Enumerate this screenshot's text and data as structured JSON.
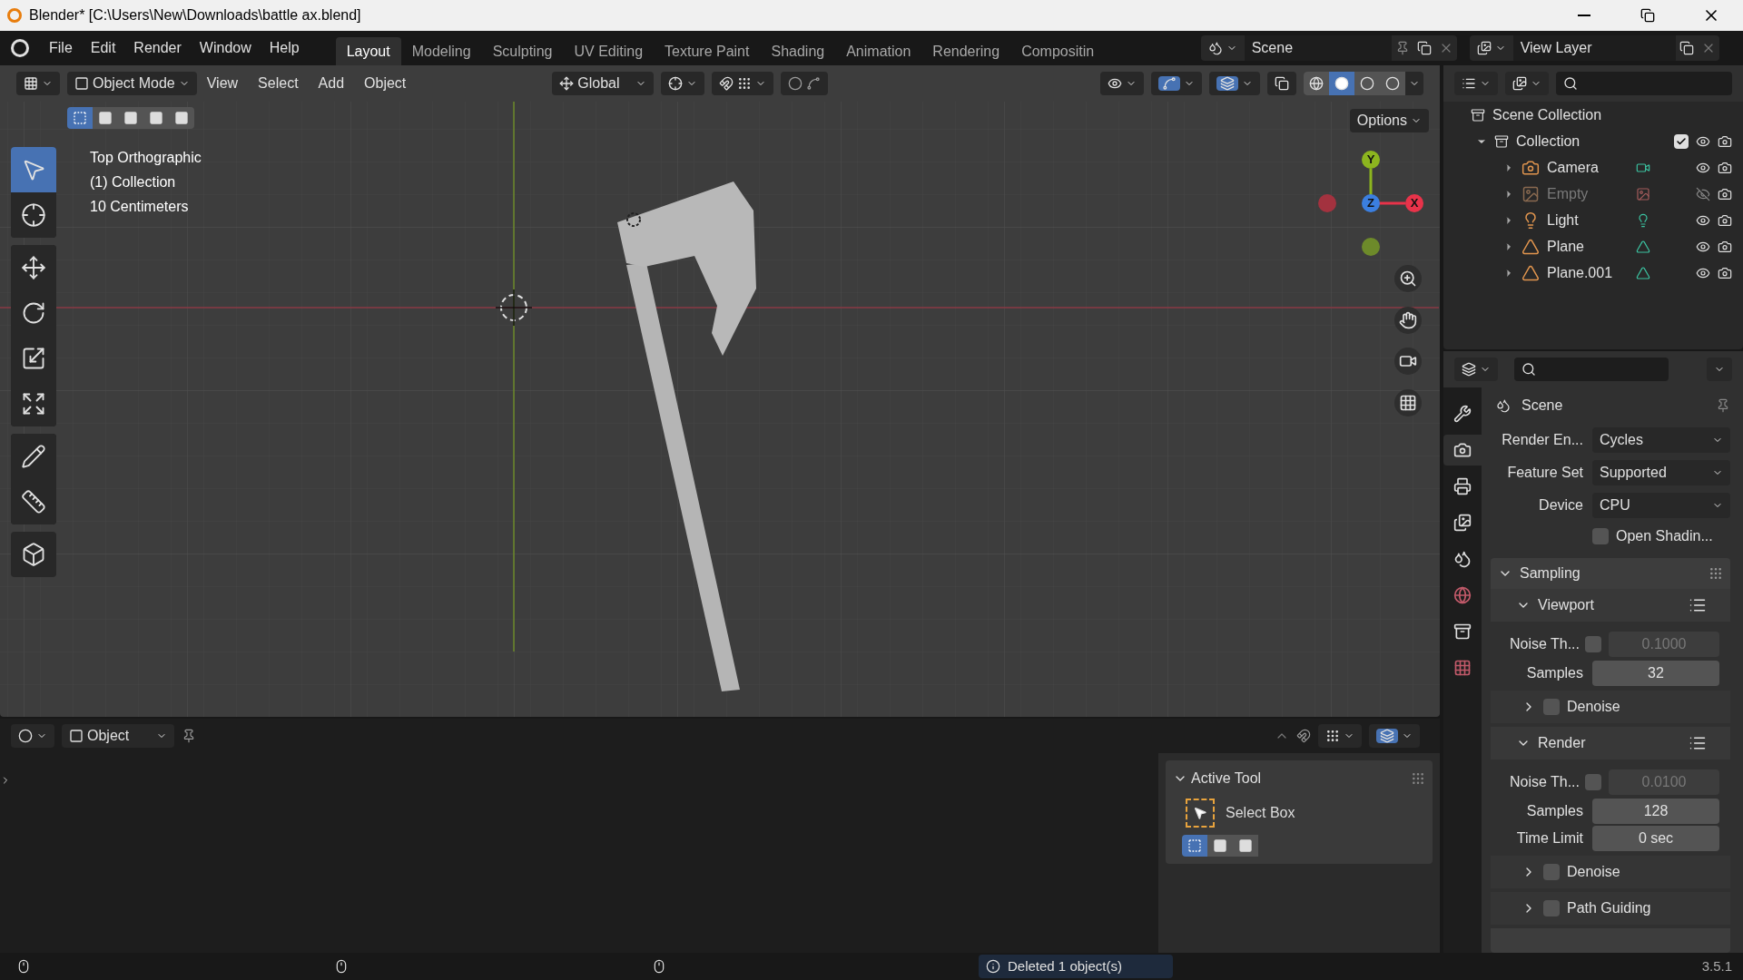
{
  "window": {
    "title": "Blender* [C:\\Users\\New\\Downloads\\battle ax.blend]"
  },
  "menu": [
    "File",
    "Edit",
    "Render",
    "Window",
    "Help"
  ],
  "workspaces": [
    {
      "label": "Layout",
      "selected": true
    },
    {
      "label": "Modeling",
      "selected": false
    },
    {
      "label": "Sculpting",
      "selected": false
    },
    {
      "label": "UV Editing",
      "selected": false
    },
    {
      "label": "Texture Paint",
      "selected": false
    },
    {
      "label": "Shading",
      "selected": false
    },
    {
      "label": "Animation",
      "selected": false
    },
    {
      "label": "Rendering",
      "selected": false
    },
    {
      "label": "Compositin",
      "selected": false
    }
  ],
  "scene": "Scene",
  "view_layer": "View Layer",
  "viewport": {
    "mode": "Object Mode",
    "menus": [
      "View",
      "Select",
      "Add",
      "Object"
    ],
    "orientation": "Global",
    "options": "Options",
    "select_modes": [
      {
        "selected": true
      },
      {
        "selected": false
      },
      {
        "selected": false
      },
      {
        "selected": false
      },
      {
        "selected": false
      }
    ],
    "shading_modes": [
      {
        "kind": "wire",
        "selected": false
      },
      {
        "kind": "solid",
        "selected": true
      },
      {
        "kind": "material",
        "selected": false
      },
      {
        "kind": "rendered",
        "selected": false
      }
    ],
    "info": [
      "Top Orthographic",
      "(1) Collection",
      "10 Centimeters"
    ],
    "axes": [
      {
        "label": "Y",
        "color": "#8cb51f"
      },
      {
        "label": "Z",
        "color": "#3b7fe0"
      },
      {
        "label": "X",
        "color": "#e8334a"
      }
    ],
    "tool_groups": [
      {
        "tools": [
          {
            "kind": "select",
            "selected": true
          },
          {
            "kind": "cursor",
            "selected": false
          }
        ]
      },
      {
        "tools": [
          {
            "kind": "move",
            "selected": false
          },
          {
            "kind": "rotate",
            "selected": false
          },
          {
            "kind": "scale",
            "selected": false
          },
          {
            "kind": "transform",
            "selected": false
          }
        ]
      },
      {
        "tools": [
          {
            "kind": "annotate",
            "selected": false
          },
          {
            "kind": "measure",
            "selected": false
          }
        ]
      },
      {
        "tools": [
          {
            "kind": "add",
            "selected": false
          }
        ]
      }
    ]
  },
  "outliner": {
    "root": "Scene Collection",
    "collection": {
      "label": "Collection",
      "expanded": true,
      "checked": true,
      "children": [
        {
          "label": "Camera",
          "kind": "camera",
          "visible": true
        },
        {
          "label": "Empty",
          "kind": "image",
          "visible": false
        },
        {
          "label": "Light",
          "kind": "light",
          "visible": true
        },
        {
          "label": "Plane",
          "kind": "mesh",
          "visible": true
        },
        {
          "label": "Plane.001",
          "kind": "mesh",
          "visible": true
        }
      ]
    }
  },
  "properties": {
    "title": "Scene",
    "tabs": [
      {
        "kind": "tool",
        "selected": false
      },
      {
        "kind": "render",
        "selected": true
      },
      {
        "kind": "output",
        "selected": false
      },
      {
        "kind": "view_layer",
        "selected": false
      },
      {
        "kind": "scene",
        "selected": false
      },
      {
        "kind": "world",
        "selected": false
      },
      {
        "kind": "collection",
        "selected": false
      },
      {
        "kind": "texture",
        "selected": false
      }
    ],
    "fields": [
      {
        "label": "Render En...",
        "value": "Cycles"
      },
      {
        "label": "Feature Set",
        "value": "Supported"
      },
      {
        "label": "Device",
        "value": "CPU"
      }
    ],
    "open_shading": {
      "label": "Open Shadin...",
      "checked": false
    },
    "sampling": {
      "title": "Sampling",
      "expanded": true,
      "sections": [
        {
          "title": "Viewport",
          "expanded": true,
          "noise": {
            "label": "Noise Th...",
            "checked": false,
            "value": "0.1000"
          },
          "rows": [
            {
              "label": "Samples",
              "value": "32"
            }
          ],
          "subs": [
            {
              "label": "Denoise",
              "checked": false,
              "expanded": false
            }
          ]
        },
        {
          "title": "Render",
          "expanded": true,
          "noise": {
            "label": "Noise Th...",
            "checked": false,
            "value": "0.0100"
          },
          "rows": [
            {
              "label": "Samples",
              "value": "128"
            },
            {
              "label": "Time Limit",
              "value": "0 sec"
            }
          ],
          "subs": [
            {
              "label": "Denoise",
              "checked": false,
              "expanded": false
            },
            {
              "label": "Path Guiding",
              "checked": false,
              "expanded": false
            }
          ]
        }
      ]
    }
  },
  "editor": {
    "mode": "Object",
    "active_tool": {
      "title": "Active Tool",
      "expanded": true,
      "tool": "Select Box",
      "select_modes": [
        {
          "selected": true
        },
        {
          "selected": false
        },
        {
          "selected": false
        }
      ]
    }
  },
  "status": {
    "message": "Deleted 1 object(s)",
    "version": "3.5.1"
  }
}
